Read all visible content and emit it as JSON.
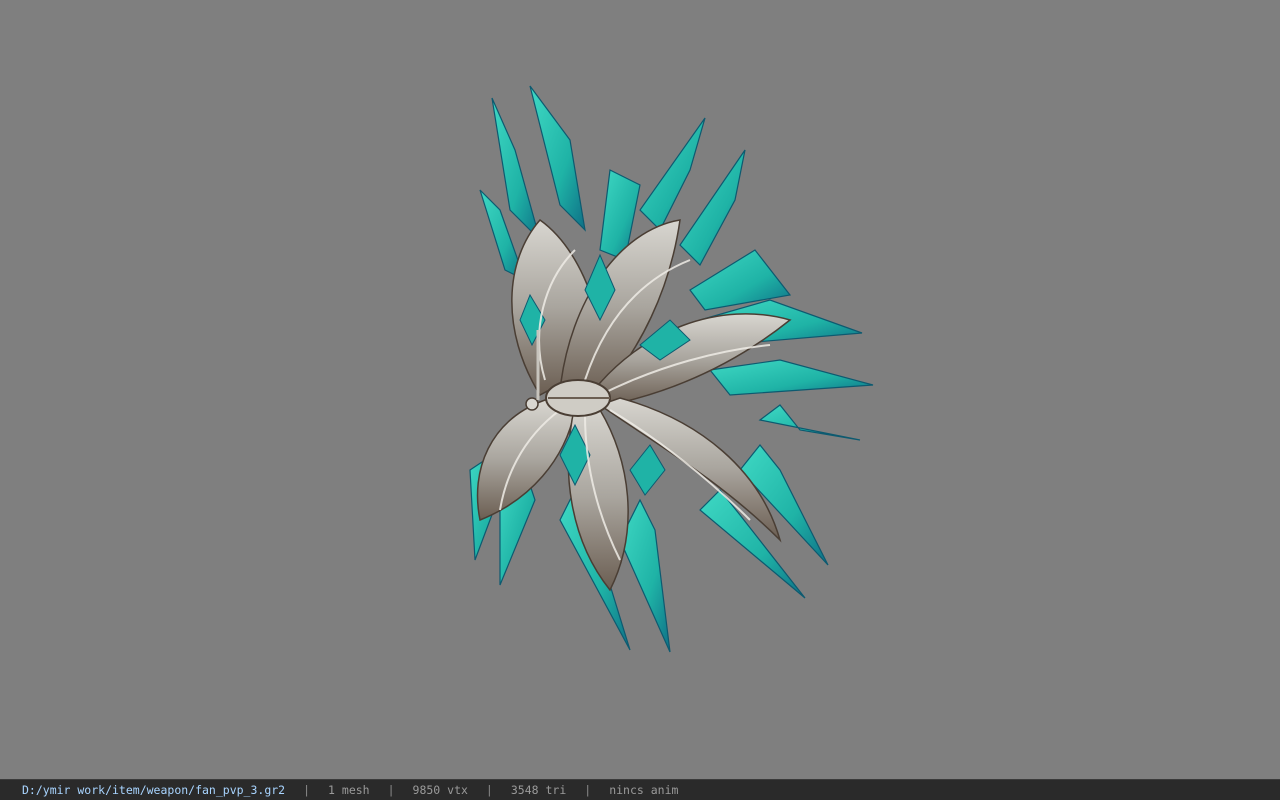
{
  "viewer": {
    "background_color": "#7f7f7f",
    "model_icon": "ornate-fan-model"
  },
  "status_bar": {
    "file_path": "D:/ymir work/item/weapon/fan_pvp_3.gr2",
    "mesh_count": "1 mesh",
    "vertex_count": "9850 vtx",
    "triangle_count": "3548 tri",
    "animation_status": "nincs anim",
    "separator": "|"
  },
  "colors": {
    "feather": "#1fb3a6",
    "feather_light": "#3fd9c4",
    "feather_dark": "#0e6f86",
    "metal": "#b9b6b0",
    "metal_dark": "#5a4a3e"
  }
}
